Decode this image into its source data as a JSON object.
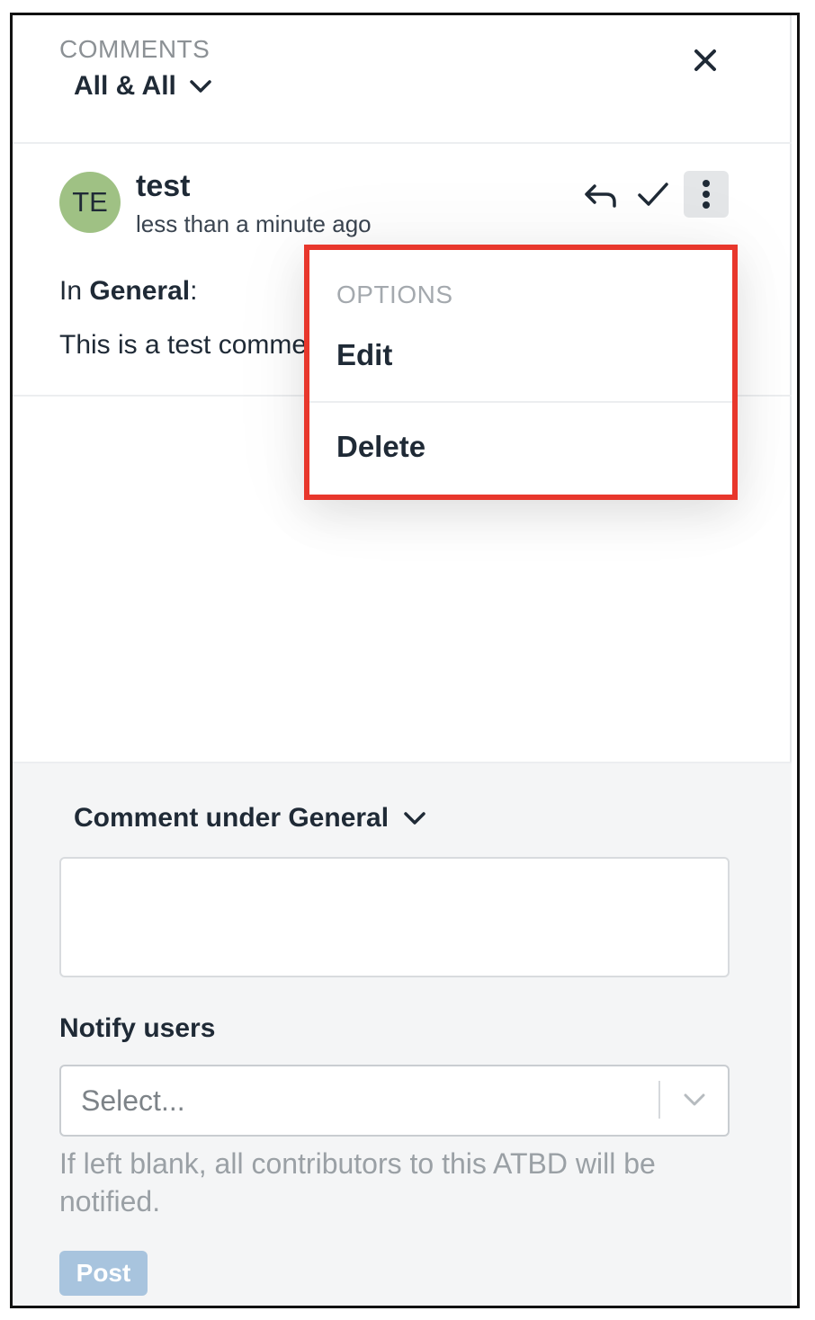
{
  "header": {
    "section_label": "COMMENTS",
    "filter_label": "All & All",
    "icons": {
      "filter": "chevron-down-icon",
      "close": "close-icon"
    }
  },
  "comment": {
    "avatar_initials": "TE",
    "avatar_color": "#9fc184",
    "author": "test",
    "timestamp": "less than a minute ago",
    "section_prefix": "In ",
    "section_name": "General",
    "section_suffix": ":",
    "body": "This is a test comment",
    "actions": {
      "reply": "reply-icon",
      "resolve": "check-icon",
      "more": "more-vertical-icon"
    }
  },
  "options_menu": {
    "heading": "OPTIONS",
    "items": [
      {
        "label": "Edit"
      },
      {
        "label": "Delete"
      }
    ],
    "highlight_color": "#e8372c"
  },
  "composer": {
    "comment_under_label": "Comment under General",
    "comment_value": "",
    "notify_label": "Notify users",
    "notify_placeholder": "Select...",
    "helper_text": "If left blank, all contributors to this ATBD will be notified.",
    "post_label": "Post",
    "post_color": "#a8c4de"
  }
}
